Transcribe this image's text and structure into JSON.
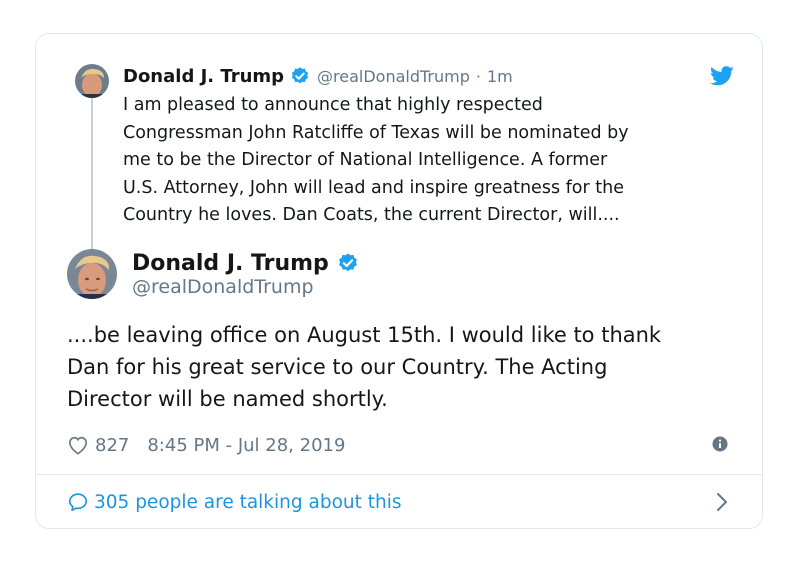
{
  "parent_tweet": {
    "author_name": "Donald J. Trump",
    "handle": "@realDonaldTrump",
    "separator": "·",
    "time_ago": "1m",
    "text_lines": [
      "I am pleased to announce that highly respected",
      "Congressman John Ratcliffe of Texas will be nominated by",
      "me to be the Director of National Intelligence. A former",
      "U.S. Attorney, John will lead and inspire greatness for the",
      "Country he loves. Dan Coats, the current Director, will...."
    ]
  },
  "main_tweet": {
    "author_name": "Donald J. Trump",
    "handle": "@realDonaldTrump",
    "text_lines": [
      "....be leaving office on August 15th. I would like to thank",
      "Dan for his great service to our Country. The Acting",
      "Director will be named shortly."
    ],
    "like_count": "827",
    "timestamp": "8:45 PM - Jul 28, 2019",
    "talking_text": "305 people are talking about this"
  },
  "icons": {
    "brand": "twitter-bird-icon",
    "verified": "verified-badge-icon",
    "like": "heart-icon",
    "info": "info-icon",
    "reply": "speech-bubble-icon",
    "chevron": "chevron-right-icon"
  },
  "colors": {
    "accent": "#1da1f2",
    "link": "#1b95e0",
    "muted": "#657786",
    "text": "#14171a",
    "border": "#e1e8ed"
  }
}
